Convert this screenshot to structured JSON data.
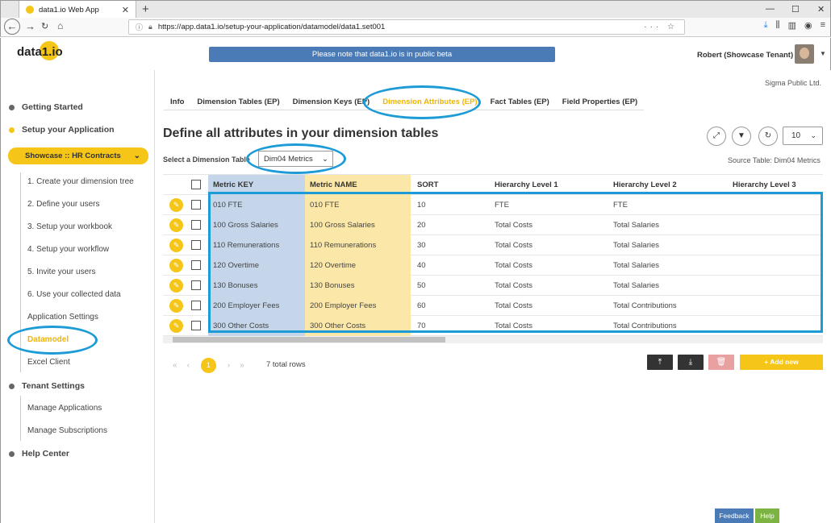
{
  "browser": {
    "tab_title": "data1.io Web App",
    "url": "https://app.data1.io/setup-your-application/datamodel/data1.set001"
  },
  "header": {
    "logo": "data1.io",
    "beta_notice": "Please note that data1.io is in public beta",
    "user": "Robert (Showcase Tenant)"
  },
  "sidebar": {
    "getting_started": "Getting Started",
    "setup": "Setup your Application",
    "showcase": "Showcase :: HR Contracts",
    "items": [
      "1. Create your dimension tree",
      "2. Define your users",
      "3. Setup your workbook",
      "4. Setup your workflow",
      "5. Invite your users",
      "6. Use your collected data",
      "Application Settings",
      "Datamodel",
      "Excel Client"
    ],
    "tenant_settings": "Tenant Settings",
    "tenant_items": [
      "Manage Applications",
      "Manage Subscriptions"
    ],
    "help_center": "Help Center"
  },
  "main": {
    "company": "Sigma Public Ltd.",
    "tabs": [
      "Info",
      "Dimension Tables (EP)",
      "Dimension Keys (EP)",
      "Dimension Attributes (EP)",
      "Fact Tables (EP)",
      "Field Properties (EP)"
    ],
    "active_tab": 3,
    "title": "Define all attributes in your dimension tables",
    "select_label": "Select a Dimension Table",
    "selected_table": "Dim04 Metrics",
    "source_table": "Source Table: Dim04 Metrics",
    "page_size": "10",
    "columns": [
      "Metric KEY",
      "Metric NAME",
      "SORT",
      "Hierarchy Level 1",
      "Hierarchy Level 2",
      "Hierarchy Level 3"
    ],
    "rows": [
      [
        "010 FTE",
        "010 FTE",
        "10",
        "FTE",
        "FTE",
        ""
      ],
      [
        "100 Gross Salaries",
        "100 Gross Salaries",
        "20",
        "Total Costs",
        "Total Salaries",
        ""
      ],
      [
        "110 Remunerations",
        "110 Remunerations",
        "30",
        "Total Costs",
        "Total Salaries",
        ""
      ],
      [
        "120 Overtime",
        "120 Overtime",
        "40",
        "Total Costs",
        "Total Salaries",
        ""
      ],
      [
        "130 Bonuses",
        "130 Bonuses",
        "50",
        "Total Costs",
        "Total Salaries",
        ""
      ],
      [
        "200 Employer Fees",
        "200 Employer Fees",
        "60",
        "Total Costs",
        "Total Contributions",
        ""
      ],
      [
        "300 Other Costs",
        "300 Other Costs",
        "70",
        "Total Costs",
        "Total Contributions",
        ""
      ]
    ],
    "current_page": "1",
    "total_rows": "7 total rows",
    "add_new": "+ Add new"
  },
  "footer": {
    "feedback": "Feedback",
    "help": "Help"
  },
  "colors": {
    "accent": "#f5c518",
    "highlight": "#1d9bd6",
    "key_col": "#c5d6ea",
    "name_col": "#fbe7a8"
  }
}
